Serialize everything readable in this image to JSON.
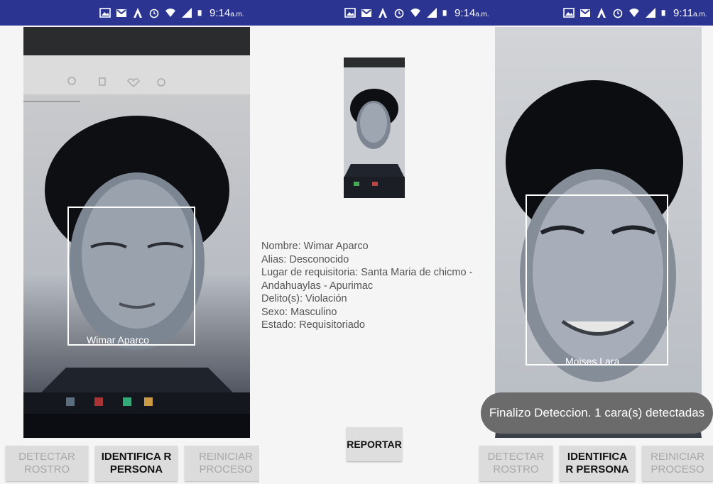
{
  "status_bars": [
    {
      "time": "9:14",
      "ampm": "a.m."
    },
    {
      "time": "9:14",
      "ampm": "a.m."
    },
    {
      "time": "9:11",
      "ampm": "a.m."
    }
  ],
  "left_screen": {
    "face_label": "Wimar Aparco",
    "buttons": {
      "detect": "DETECTAR ROSTRO",
      "identify": "IDENTIFICA R PERSONA",
      "reset": "REINICIAR PROCESO"
    }
  },
  "middle_screen": {
    "info": {
      "nombre": "Nombre: Wimar Aparco",
      "alias": "Alias: Desconocido",
      "lugar_1": "Lugar de requisitoria: Santa Maria de chicmo -",
      "lugar_2": "Andahuaylas - Apurimac",
      "delito": "Delito(s): Violación",
      "sexo": "Sexo: Masculino",
      "estado": "Estado: Requisitoriado"
    },
    "report_button": "REPORTAR"
  },
  "right_screen": {
    "face_label": "Moises Lara",
    "toast": "Finalizo Deteccion. 1 cara(s) detectadas",
    "buttons": {
      "detect": "DETECTAR ROSTRO",
      "identify": "IDENTIFICA R PERSONA",
      "reset": "REINICIAR PROCESO"
    }
  },
  "colors": {
    "status_bar": "#2b3591",
    "button_bg": "#dcdcdc",
    "toast_bg": "#6b6b6b"
  }
}
